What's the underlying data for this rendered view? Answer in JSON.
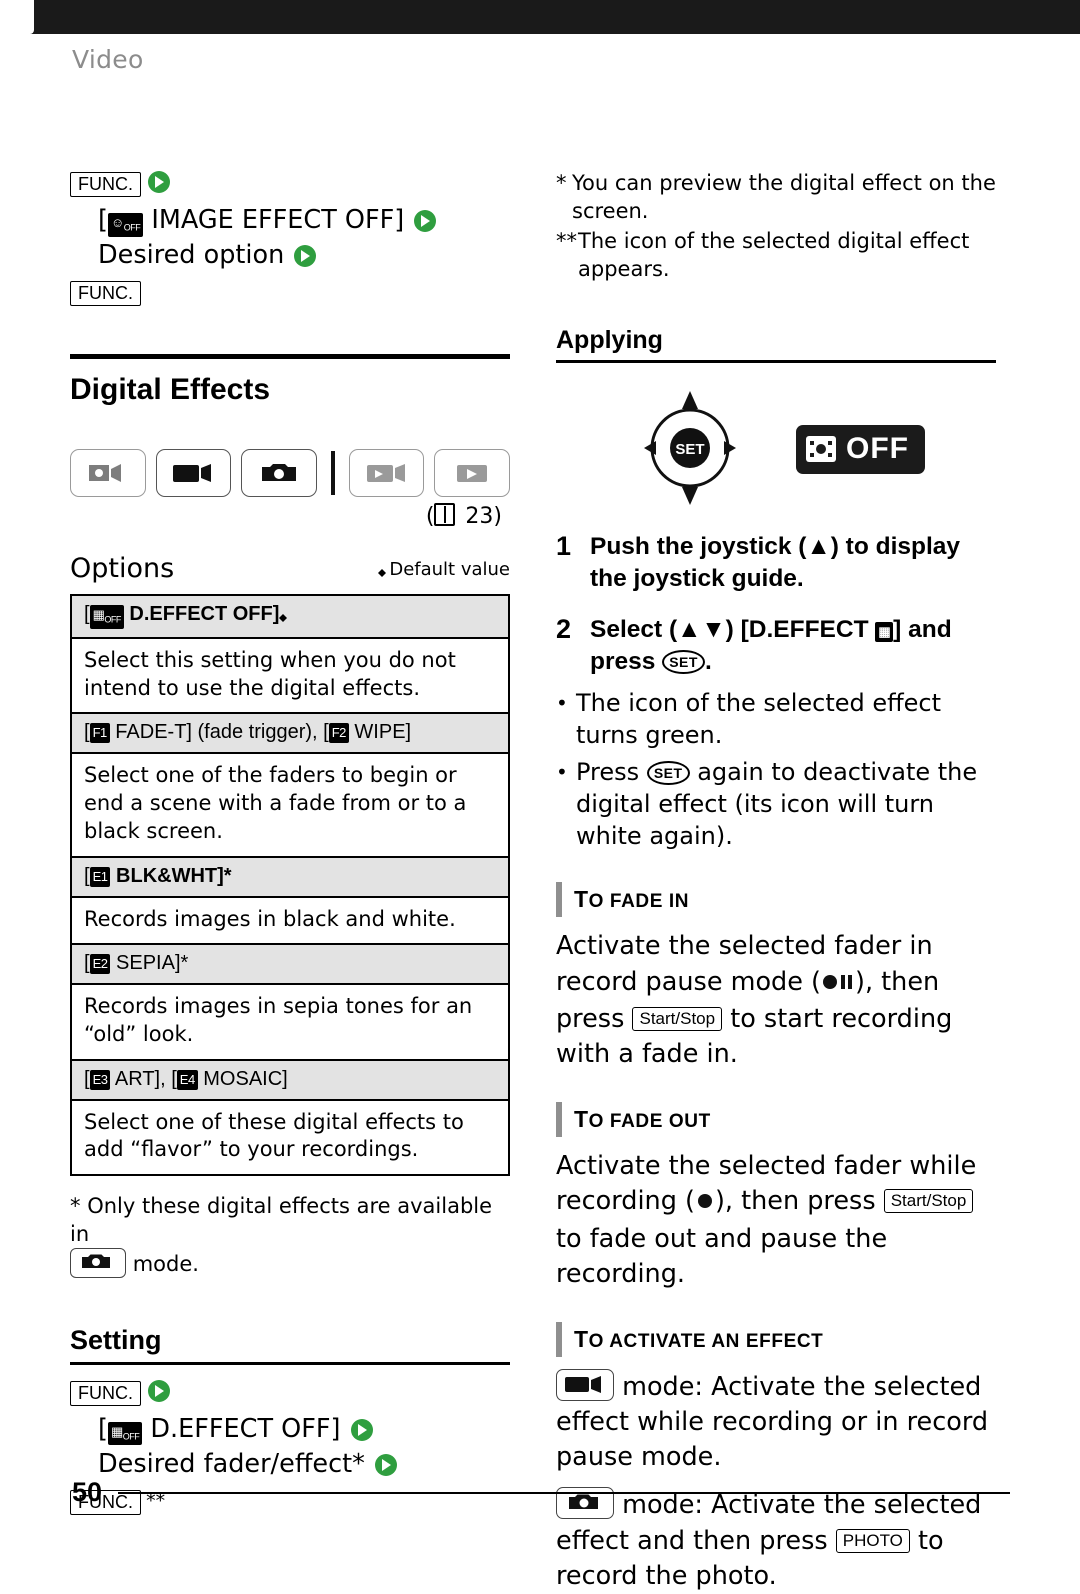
{
  "page": {
    "section_label": "Video",
    "page_number": "50"
  },
  "left": {
    "func_sequence_top": {
      "func_label": "FUNC.",
      "line1": "[",
      "option_icon": "image-effect-off-icon",
      "line1_text": "IMAGE EFFECT OFF]",
      "line2": "Desired option",
      "func_label_end": "FUNC."
    },
    "heading": "Digital Effects",
    "mode_icons": [
      "dual-shot-icon",
      "movie-icon",
      "photo-icon",
      "playback-movie-icon",
      "playback-photo-icon"
    ],
    "page_ref": "23",
    "options": {
      "title": "Options",
      "default_note": "Default value",
      "rows": [
        {
          "header_prefix": "[",
          "header_icon": "d-effect-off-icon",
          "header": "D.EFFECT OFF]",
          "header_suffix": "default-marker",
          "body": "Select this setting when you do not intend to use the digital effects."
        },
        {
          "header_prefix": "[",
          "header_icon": "f1-icon",
          "header": "FADE-T] (fade trigger), [",
          "header_icon2": "f2-icon",
          "header2": "WIPE]",
          "body": "Select one of the faders to begin or end a scene with a fade from or to a black screen."
        },
        {
          "header_prefix": "[",
          "header_icon": "e1-icon",
          "header": "BLK&WHT]*",
          "body": "Records images in black and white."
        },
        {
          "header_prefix": "[",
          "header_icon": "e2-icon",
          "header": "SEPIA]*",
          "body": "Records images in sepia tones for an “old” look."
        },
        {
          "header_prefix": "[",
          "header_icon": "e3-icon",
          "header": "ART], [",
          "header_icon2": "e4-icon",
          "header2": "MOSAIC]",
          "body": "Select one of these digital effects to add “flavor” to your recordings."
        }
      ],
      "footnote_mark": "*",
      "footnote_text_1": "Only these digital effects are available in",
      "footnote_icon": "photo-mode-icon",
      "footnote_text_2": "mode."
    },
    "setting": {
      "title": "Setting",
      "func_label": "FUNC.",
      "line1_prefix": "[",
      "line1_icon": "d-effect-off-icon",
      "line1": "D.EFFECT OFF]",
      "line2": "Desired fader/effect*",
      "func_label_end": "FUNC.",
      "func_end_marks": "**"
    }
  },
  "right": {
    "notes": [
      {
        "mark": "*",
        "text": "You can preview the digital effect on the screen."
      },
      {
        "mark": "**",
        "text": "The icon of the selected digital effect appears."
      }
    ],
    "applying": {
      "title": "Applying",
      "joystick_icon": "joystick-guide-icon",
      "set_label": "SET",
      "badge_icon": "d-effect-icon",
      "badge_label": "OFF",
      "steps": [
        {
          "num": "1",
          "text_a": "Push the joystick (",
          "arrow": "up-arrow-icon",
          "text_b": ") to display the joystick guide."
        },
        {
          "num": "2",
          "text_a": "Select (",
          "arrow": "up-down-arrow-icon",
          "text_b": ") [D.EFFECT",
          "icon": "d-effect-small-icon",
          "text_c": "] and press",
          "set_label": "SET",
          "text_d": "."
        }
      ],
      "bullets": [
        {
          "text": "The icon of the selected effect turns green."
        },
        {
          "text_a": "Press",
          "set_label": "SET",
          "text_b": "again to deactivate the digital effect (its icon will turn white again)."
        }
      ],
      "sections": [
        {
          "heading_first": "T",
          "heading_rest": "O FADE IN",
          "body_a": "Activate the selected fader in record pause mode (",
          "icon": "rec-pause-icon",
          "body_b": "), then press",
          "key": "Start/Stop",
          "body_c": "to start recording with a fade in."
        },
        {
          "heading_first": "T",
          "heading_rest": "O FADE OUT",
          "body_a": "Activate the selected fader while recording (",
          "icon": "rec-icon",
          "body_b": "), then press",
          "key": "Start/Stop",
          "body_c": "to fade out and pause the recording."
        },
        {
          "heading_first": "T",
          "heading_rest": "O ACTIVATE AN EFFECT",
          "mode_line1_icon": "movie-mode-icon",
          "mode_line1": "mode: Activate the selected effect while recording or in record pause mode.",
          "mode_line2_icon": "photo-mode-icon",
          "mode_line2_a": "mode: Activate the selected effect and then press",
          "key": "PHOTO",
          "mode_line2_b": "to record the photo."
        }
      ]
    }
  },
  "colors": {
    "arrow_green": "#2f9e3f",
    "header_gray": "#e3e3e3",
    "label_gray": "#8c8c8c"
  }
}
